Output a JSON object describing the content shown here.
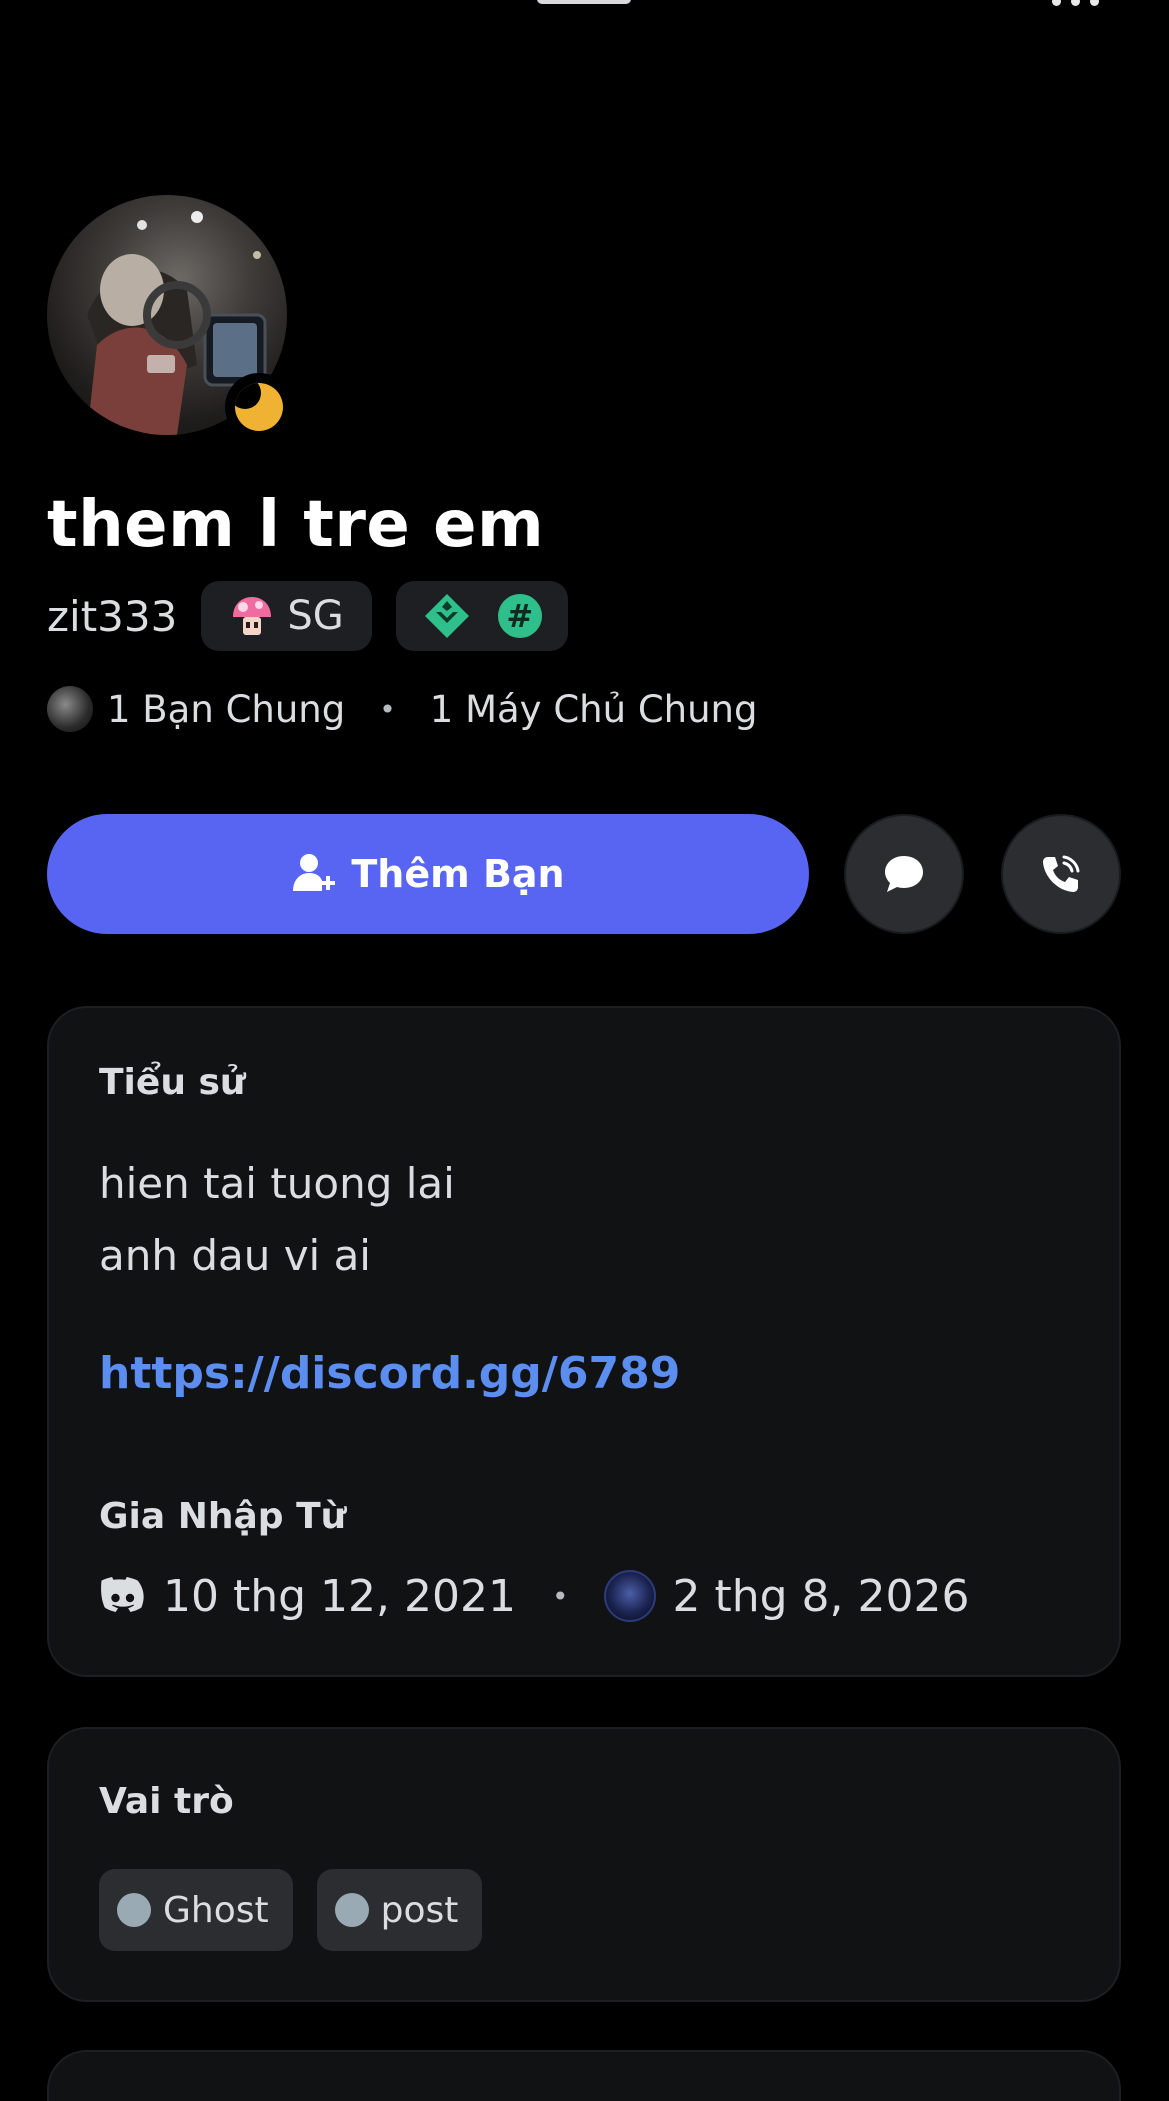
{
  "profile": {
    "display_name": "them l tre em",
    "username": "zit333",
    "status": "idle",
    "tag_label": "SG",
    "badge_hash_label": "#"
  },
  "mutuals": {
    "friends": "1 Bạn Chung",
    "separator": "•",
    "servers": "1 Máy Chủ Chung"
  },
  "actions": {
    "add_friend_label": "Thêm Bạn",
    "message_icon": "chat-bubble-icon",
    "call_icon": "phone-call-icon"
  },
  "bio": {
    "title": "Tiểu sử",
    "line1": "hien tai tuong lai",
    "line2": "anh dau vi ai",
    "link": "https://discord.gg/6789"
  },
  "joined": {
    "title": "Gia Nhập Từ",
    "discord_date": "10 thg 12, 2021",
    "separator": "•",
    "server_date": "2 thg 8, 2026"
  },
  "roles": {
    "title": "Vai trò",
    "items": [
      {
        "name": "Ghost",
        "color": "#99aab5"
      },
      {
        "name": "post",
        "color": "#99aab5"
      }
    ]
  },
  "colors": {
    "accent": "#5865f2",
    "link": "#5b8ef0",
    "idle": "#f0b232",
    "card": "#111214"
  }
}
